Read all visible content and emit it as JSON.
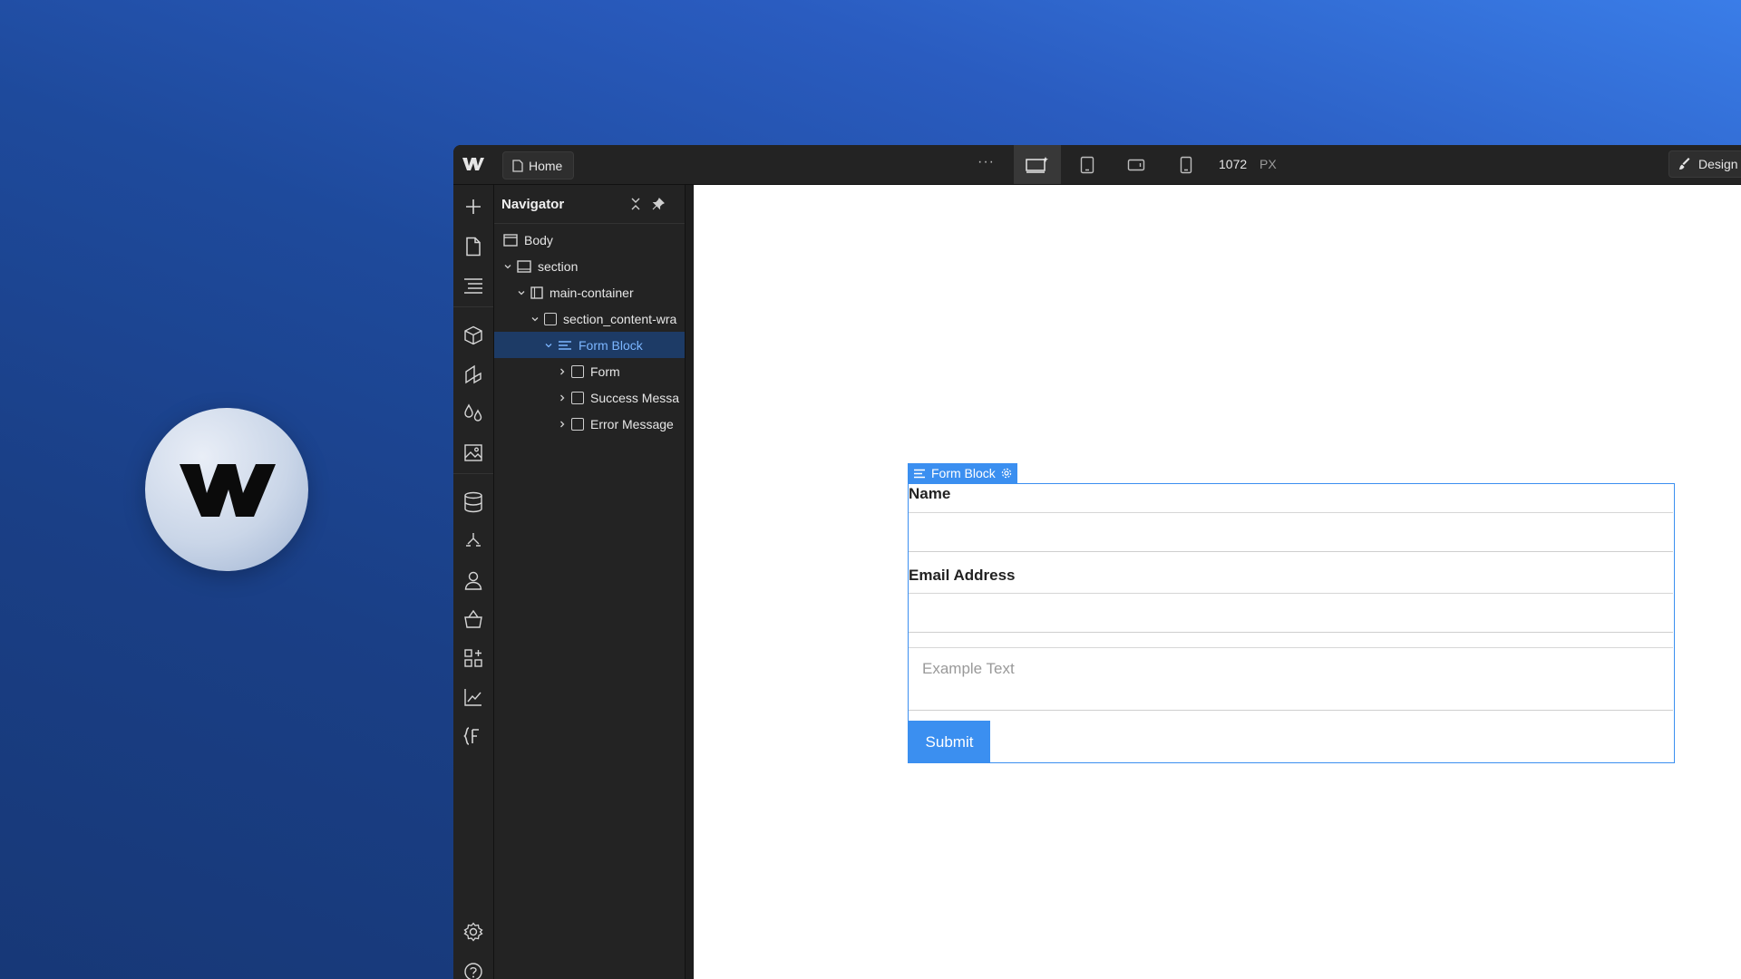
{
  "topbar": {
    "page_name": "Home",
    "more_label": "···",
    "width_value": "1072",
    "width_unit": "PX",
    "design_label": "Design"
  },
  "navigator": {
    "title": "Navigator",
    "tree": [
      {
        "label": "Body",
        "depth": 0,
        "caret": false,
        "icon": "body-icon"
      },
      {
        "label": "section",
        "depth": 0,
        "caret": "open",
        "icon": "section-icon"
      },
      {
        "label": "main-container",
        "depth": 1,
        "caret": "open",
        "icon": "container-icon"
      },
      {
        "label": "section_content-wra",
        "depth": 2,
        "caret": "open",
        "icon": "div-icon"
      },
      {
        "label": "Form Block",
        "depth": 3,
        "caret": "open",
        "icon": "form-block-icon",
        "selected": true
      },
      {
        "label": "Form",
        "depth": 4,
        "caret": "closed",
        "icon": "div-icon"
      },
      {
        "label": "Success Messa",
        "depth": 4,
        "caret": "closed",
        "icon": "div-icon"
      },
      {
        "label": "Error Message",
        "depth": 4,
        "caret": "closed",
        "icon": "div-icon"
      }
    ]
  },
  "canvas": {
    "selection_tag": "Form Block",
    "form": {
      "name_label": "Name",
      "email_label": "Email Address",
      "textarea_placeholder": "Example Text",
      "submit_label": "Submit"
    }
  },
  "colors": {
    "accent": "#3b8ff0",
    "selected_bg": "#1d3b66",
    "panel_bg": "#232323"
  }
}
